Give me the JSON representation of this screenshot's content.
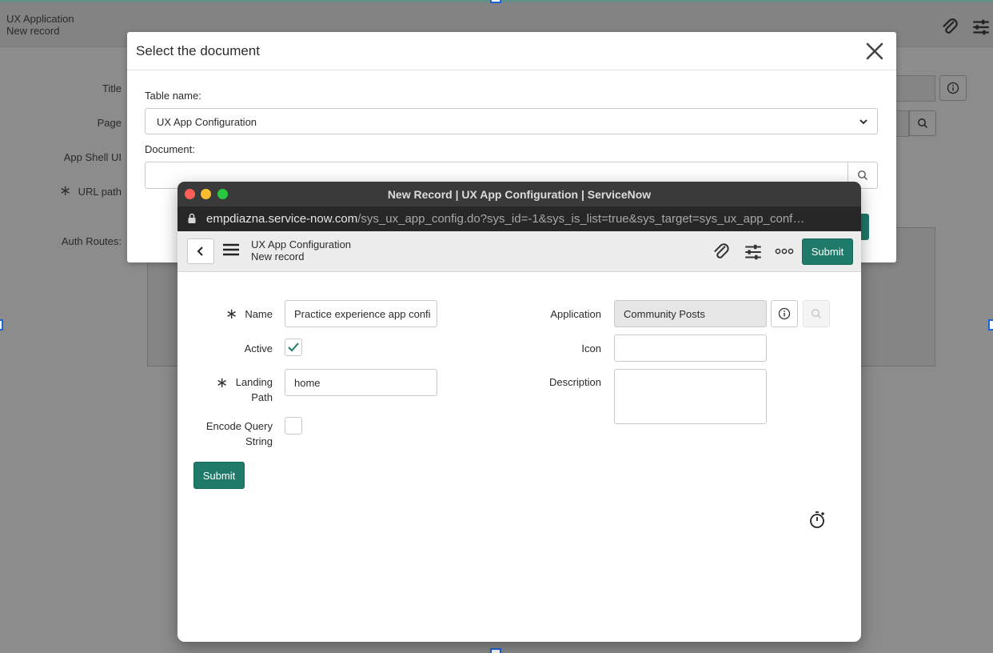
{
  "background": {
    "app_title": "UX Application",
    "app_subtitle": "New record",
    "labels": {
      "title": "Title",
      "page": "Page",
      "app_shell_ui": "App Shell UI",
      "url_path": "URL path",
      "auth_routes": "Auth Routes:"
    }
  },
  "dialog": {
    "title": "Select the document",
    "table_name_label": "Table name:",
    "table_name_value": "UX App Configuration",
    "document_label": "Document:",
    "document_value": ""
  },
  "browser": {
    "window_title": "New Record | UX App Configuration | ServiceNow",
    "url_host": "empdiazna.service-now.com",
    "url_path": "/sys_ux_app_config.do?sys_id=-1&sys_is_list=true&sys_target=sys_ux_app_conf…",
    "app_header": {
      "title": "UX App Configuration",
      "subtitle": "New record",
      "submit_label": "Submit"
    },
    "form": {
      "name_label": "Name",
      "name_value": "Practice experience app confi",
      "active_label": "Active",
      "active_checked": true,
      "landing_path_label_1": "Landing",
      "landing_path_label_2": "Path",
      "landing_path_value": "home",
      "encode_query_label_1": "Encode Query",
      "encode_query_label_2": "String",
      "encode_query_checked": false,
      "application_label": "Application",
      "application_value": "Community Posts",
      "icon_label": "Icon",
      "icon_value": "",
      "description_label": "Description",
      "description_value": "",
      "submit_label": "Submit"
    }
  },
  "colors": {
    "accent": "#1f7a6a",
    "window_close": "#ff5f57",
    "window_minimize": "#febc2e",
    "window_zoom": "#28c840"
  }
}
